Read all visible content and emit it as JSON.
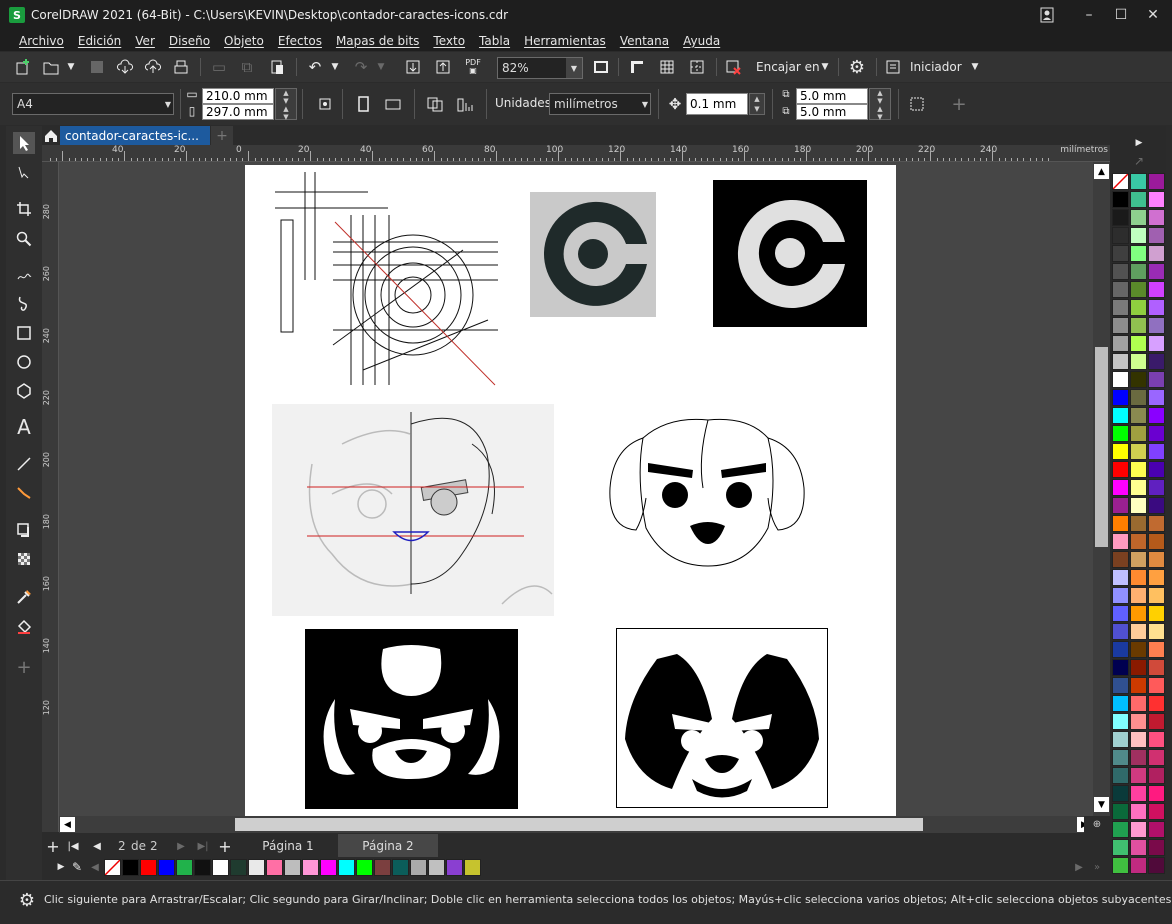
{
  "window": {
    "title": "CorelDRAW 2021 (64-Bit) - C:\\Users\\KEVIN\\Desktop\\contador-caractes-icons.cdr",
    "minimize": "–",
    "maximize": "☐",
    "close": "✕"
  },
  "menu": [
    "Archivo",
    "Edición",
    "Ver",
    "Diseño",
    "Objeto",
    "Efectos",
    "Mapas de bits",
    "Texto",
    "Tabla",
    "Herramientas",
    "Ventana",
    "Ayuda"
  ],
  "toolbar": {
    "zoom_value": "82%",
    "fit_label": "Encajar en",
    "launcher_label": "Iniciador"
  },
  "property_bar": {
    "page_size": "A4",
    "width": "210.0 mm",
    "height": "297.0 mm",
    "units_label": "Unidades:",
    "units_value": "milímetros",
    "nudge": "0.1 mm",
    "dup_x": "5.0 mm",
    "dup_y": "5.0 mm"
  },
  "document_tab": {
    "label": "contador-caractes-ic..."
  },
  "ruler": {
    "top_ticks": [
      "40",
      "20",
      "0",
      "20",
      "40",
      "60",
      "80",
      "100",
      "120",
      "140",
      "160",
      "180",
      "200",
      "220",
      "240"
    ],
    "unit": "milímetros",
    "left_ticks": [
      "280",
      "260",
      "240",
      "220",
      "200",
      "180",
      "160",
      "140",
      "120"
    ]
  },
  "page_nav": {
    "current": "2",
    "of_label": "de",
    "total": "2",
    "tabs": [
      "Página 1",
      "Página 2"
    ],
    "active_tab": 1
  },
  "status": {
    "message": "Clic siguiente para Arrastrar/Escalar; Clic segundo para Girar/Inclinar; Doble clic en herramienta selecciona todos los objetos; Mayús+clic selecciona varios objetos; Alt+clic selecciona objetos subyacentes"
  },
  "colors": {
    "accent_tab": "#1d5a9e",
    "titlebar": "#1e1e1e",
    "workspace": "#464646"
  },
  "doc_palette": [
    "#000000",
    "#ff0000",
    "#0000ff",
    "#21b24b",
    "#111111",
    "#ffffff",
    "#1f3b2f",
    "#e9e9e9",
    "#ff6fa5",
    "#bdbdbd",
    "#ff96d6",
    "#ff00ff",
    "#00ffff",
    "#00ff00",
    "#7b3f3f",
    "#0b5d5a",
    "#aaaaaa",
    "#c0c0c0",
    "#8a3fd1",
    "#c6c32e"
  ],
  "palette": [
    [
      "#ffffff",
      "#39c9a5",
      "#9b1a9b"
    ],
    [
      "#000000",
      "#3fbf8f",
      "#ff80ff"
    ],
    [
      "#1a1a1a",
      "#8ed08e",
      "#d070d0"
    ],
    [
      "#2d2d2d",
      "#bfffbf",
      "#a060b0"
    ],
    [
      "#3f3f3f",
      "#80ff80",
      "#d0a0d0"
    ],
    [
      "#525252",
      "#5f9f5f",
      "#9a2bb5"
    ],
    [
      "#666666",
      "#5a8a2a",
      "#d040ff"
    ],
    [
      "#7a7a7a",
      "#8fcf3f",
      "#b060ff"
    ],
    [
      "#8d8d8d",
      "#90c050",
      "#9070c0"
    ],
    [
      "#a1a1a1",
      "#b0ff50",
      "#d7a0ff"
    ],
    [
      "#c5c5c5",
      "#d0ff90",
      "#3a1a6a"
    ],
    [
      "#ffffff",
      "#333300",
      "#7a3fb0"
    ],
    [
      "#0000ff",
      "#6a6a40",
      "#9a66ff"
    ],
    [
      "#00ffff",
      "#8a8a50",
      "#8a00ff"
    ],
    [
      "#00ff00",
      "#a0a040",
      "#6a00d0"
    ],
    [
      "#ffff00",
      "#d0d050",
      "#8040ff"
    ],
    [
      "#ff0000",
      "#ffff50",
      "#4a00b0"
    ],
    [
      "#ff00ff",
      "#ffff90",
      "#6020c0"
    ],
    [
      "#9a2090",
      "#ffffc0",
      "#3a0a80"
    ],
    [
      "#ff7f00",
      "#9a6a30",
      "#c06a30"
    ],
    [
      "#ff9ac0",
      "#c0662a",
      "#b55a1a"
    ],
    [
      "#7a4020",
      "#d0a060",
      "#e08a40"
    ],
    [
      "#c0c0ff",
      "#ff8a30",
      "#ffa040"
    ],
    [
      "#9090ff",
      "#ffb070",
      "#ffc060"
    ],
    [
      "#6060ff",
      "#ff9a00",
      "#ffd000"
    ],
    [
      "#5050d0",
      "#ffcc99",
      "#ffe090"
    ],
    [
      "#1a3aa0",
      "#6a3a00",
      "#ff7f50"
    ],
    [
      "#000050",
      "#8a1a00",
      "#d04a3a"
    ],
    [
      "#305090",
      "#cc3a00",
      "#ff5a5a"
    ],
    [
      "#00c0ff",
      "#ff6a6a",
      "#ff3030"
    ],
    [
      "#80ffff",
      "#ff9090",
      "#c01a30"
    ],
    [
      "#a0d0d0",
      "#ffc0c0",
      "#ff5080"
    ],
    [
      "#508a8a",
      "#a03060",
      "#d03070"
    ],
    [
      "#306a6a",
      "#d03a80",
      "#b02060"
    ],
    [
      "#0a3a3a",
      "#ff40a0",
      "#ff1a80"
    ],
    [
      "#0a6a3a",
      "#ff70c0",
      "#d01060"
    ],
    [
      "#20a050",
      "#ff9ad0",
      "#b0106a"
    ],
    [
      "#40c070",
      "#e050a0",
      "#7a0a4a"
    ],
    [
      "#40c040",
      "#c02a80",
      "#500a3a"
    ]
  ]
}
